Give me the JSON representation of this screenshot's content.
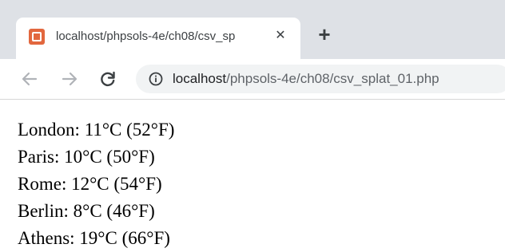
{
  "tab": {
    "title": "localhost/phpsols-4e/ch08/csv_sp",
    "close_glyph": "✕",
    "favicon": "xampp-icon"
  },
  "new_tab_glyph": "+",
  "toolbar": {
    "back_icon": "back-arrow-icon",
    "forward_icon": "forward-arrow-icon",
    "reload_icon": "reload-icon",
    "url_host": "localhost",
    "url_path": "/phpsols-4e/ch08/csv_splat_01.php"
  },
  "cities": [
    "London: 11°C (52°F)",
    "Paris: 10°C (50°F)",
    "Rome: 12°C (54°F)",
    "Berlin: 8°C (46°F)",
    "Athens: 19°C (66°F)"
  ],
  "colors": {
    "tabstrip": "#dee1e6",
    "favicon": "#e2673e",
    "omnibox": "#f1f3f4"
  }
}
